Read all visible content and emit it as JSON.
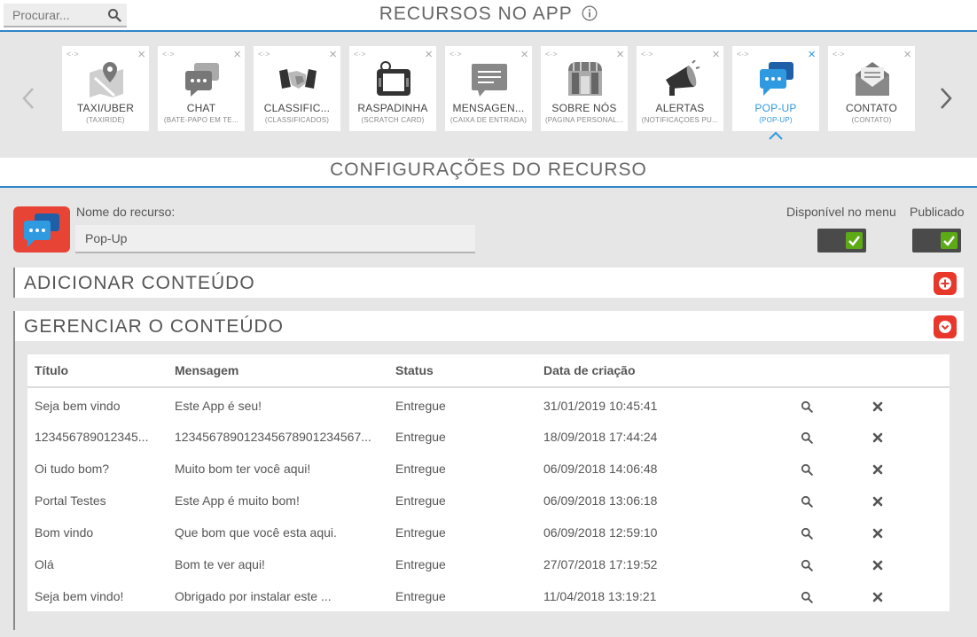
{
  "header": {
    "search_placeholder": "Procurar...",
    "title": "RECURSOS NO APP"
  },
  "carousel": {
    "cards": [
      {
        "title": "TAXI/UBER",
        "subtitle": "(TAXIRIDE)",
        "icon": "map-pin-icon",
        "active": false
      },
      {
        "title": "CHAT",
        "subtitle": "(BATE-PAPO EM TE...",
        "icon": "chat-bubbles-icon",
        "active": false
      },
      {
        "title": "CLASSIFIC...",
        "subtitle": "(CLASSIFICADOS)",
        "icon": "handshake-icon",
        "active": false
      },
      {
        "title": "RASPADINHA",
        "subtitle": "(SCRATCH CARD)",
        "icon": "scratch-card-icon",
        "active": false
      },
      {
        "title": "MENSAGEN...",
        "subtitle": "(CAIXA DE ENTRADA)",
        "icon": "message-box-icon",
        "active": false
      },
      {
        "title": "SOBRE NÓS",
        "subtitle": "(PAGINA PERSONAL...",
        "icon": "storefront-icon",
        "active": false
      },
      {
        "title": "ALERTAS",
        "subtitle": "(NOTIFICAÇOES PU...",
        "icon": "megaphone-icon",
        "active": false
      },
      {
        "title": "POP-UP",
        "subtitle": "(POP-UP)",
        "icon": "popup-chat-icon",
        "active": true
      },
      {
        "title": "CONTATO",
        "subtitle": "(CONTATO)",
        "icon": "envelope-icon",
        "active": false
      }
    ]
  },
  "config": {
    "title": "CONFIGURAÇÕES DO RECURSO",
    "name_label": "Nome do recurso:",
    "name_value": "Pop-Up",
    "menu_label": "Disponível no menu",
    "published_label": "Publicado"
  },
  "panels": {
    "add_title": "ADICIONAR CONTEÚDO",
    "manage_title": "GERENCIAR O CONTEÚDO"
  },
  "table": {
    "headers": {
      "title": "Título",
      "message": "Mensagem",
      "status": "Status",
      "date": "Data de criação"
    },
    "rows": [
      {
        "title": "Seja bem vindo",
        "message": "Este App é seu!",
        "status": "Entregue",
        "date": "31/01/2019 10:45:41"
      },
      {
        "title": "123456789012345...",
        "message": "123456789012345678901234567...",
        "status": "Entregue",
        "date": "18/09/2018 17:44:24"
      },
      {
        "title": "Oi tudo bom?",
        "message": "Muito bom ter você aqui!",
        "status": "Entregue",
        "date": "06/09/2018 14:06:48"
      },
      {
        "title": "Portal Testes",
        "message": "Este App é muito bom!",
        "status": "Entregue",
        "date": "06/09/2018 13:06:18"
      },
      {
        "title": "Bom vindo",
        "message": "Que bom que você esta aqui.",
        "status": "Entregue",
        "date": "06/09/2018 12:59:10"
      },
      {
        "title": "Olá",
        "message": "Bom te ver aqui!",
        "status": "Entregue",
        "date": "27/07/2018 17:19:52"
      },
      {
        "title": "Seja bem vindo!",
        "message": "Obrigado por instalar este ...",
        "status": "Entregue",
        "date": "11/04/2018 13:19:21"
      }
    ]
  },
  "colors": {
    "accent_blue": "#2f86c7",
    "active_blue": "#2f9ae0",
    "danger_red": "#e8372b",
    "check_green": "#5daa17"
  }
}
